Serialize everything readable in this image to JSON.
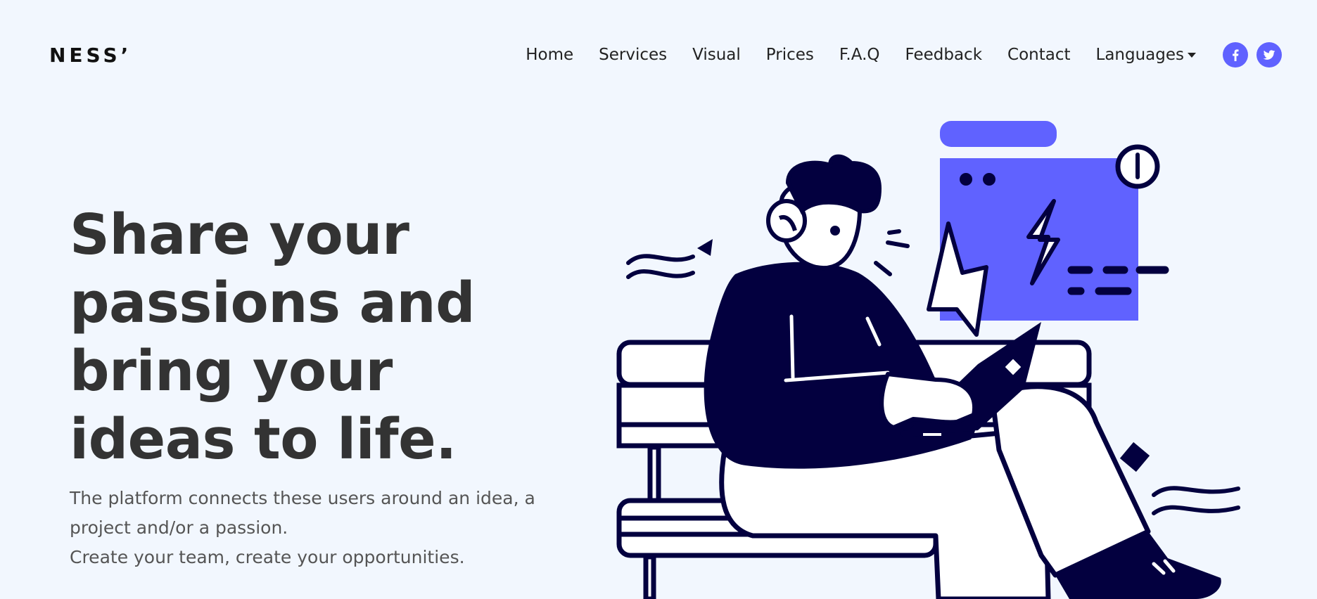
{
  "brand": {
    "name": "NESS’"
  },
  "nav": {
    "items": [
      {
        "label": "Home"
      },
      {
        "label": "Services"
      },
      {
        "label": "Visual"
      },
      {
        "label": "Prices"
      },
      {
        "label": "F.A.Q"
      },
      {
        "label": "Feedback"
      },
      {
        "label": "Contact"
      },
      {
        "label": "Languages"
      }
    ]
  },
  "social": [
    {
      "icon": "facebook-icon",
      "color": "#6c63ff"
    },
    {
      "icon": "twitter-icon",
      "color": "#6c63ff"
    }
  ],
  "hero": {
    "title": "Share your passions and bring your ideas to life.",
    "line1": "The platform connects these users around an idea, a project and/or a passion.",
    "line2": "Create your team, create your opportunities."
  },
  "colors": {
    "accent": "#6062ff",
    "dark": "#03003f",
    "background": "#f2f7fe"
  }
}
